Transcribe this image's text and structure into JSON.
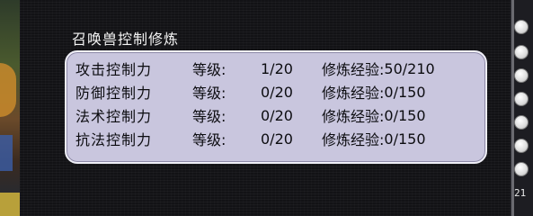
{
  "window": {
    "title": "召唤兽控制修炼"
  },
  "rows": [
    {
      "name": "攻击控制力",
      "level_label": "等级:",
      "level_value": "1/20",
      "exp_label": "修炼经验:",
      "exp_value": "50/210"
    },
    {
      "name": "防御控制力",
      "level_label": "等级:",
      "level_value": "0/20",
      "exp_label": "修炼经验:",
      "exp_value": "0/150"
    },
    {
      "name": "法术控制力",
      "level_label": "等级:",
      "level_value": "0/20",
      "exp_label": "修炼经验:",
      "exp_value": "0/150"
    },
    {
      "name": "抗法控制力",
      "level_label": "等级:",
      "level_value": "0/20",
      "exp_label": "修炼经验:",
      "exp_value": "0/150"
    }
  ],
  "sidebar": {
    "number": "21"
  },
  "colors": {
    "panel_bg": "#121215",
    "box_bg": "#c9c6de",
    "box_border": "#efeff7",
    "text_dark": "#0c0c10",
    "title_text": "#f4f4f4"
  }
}
